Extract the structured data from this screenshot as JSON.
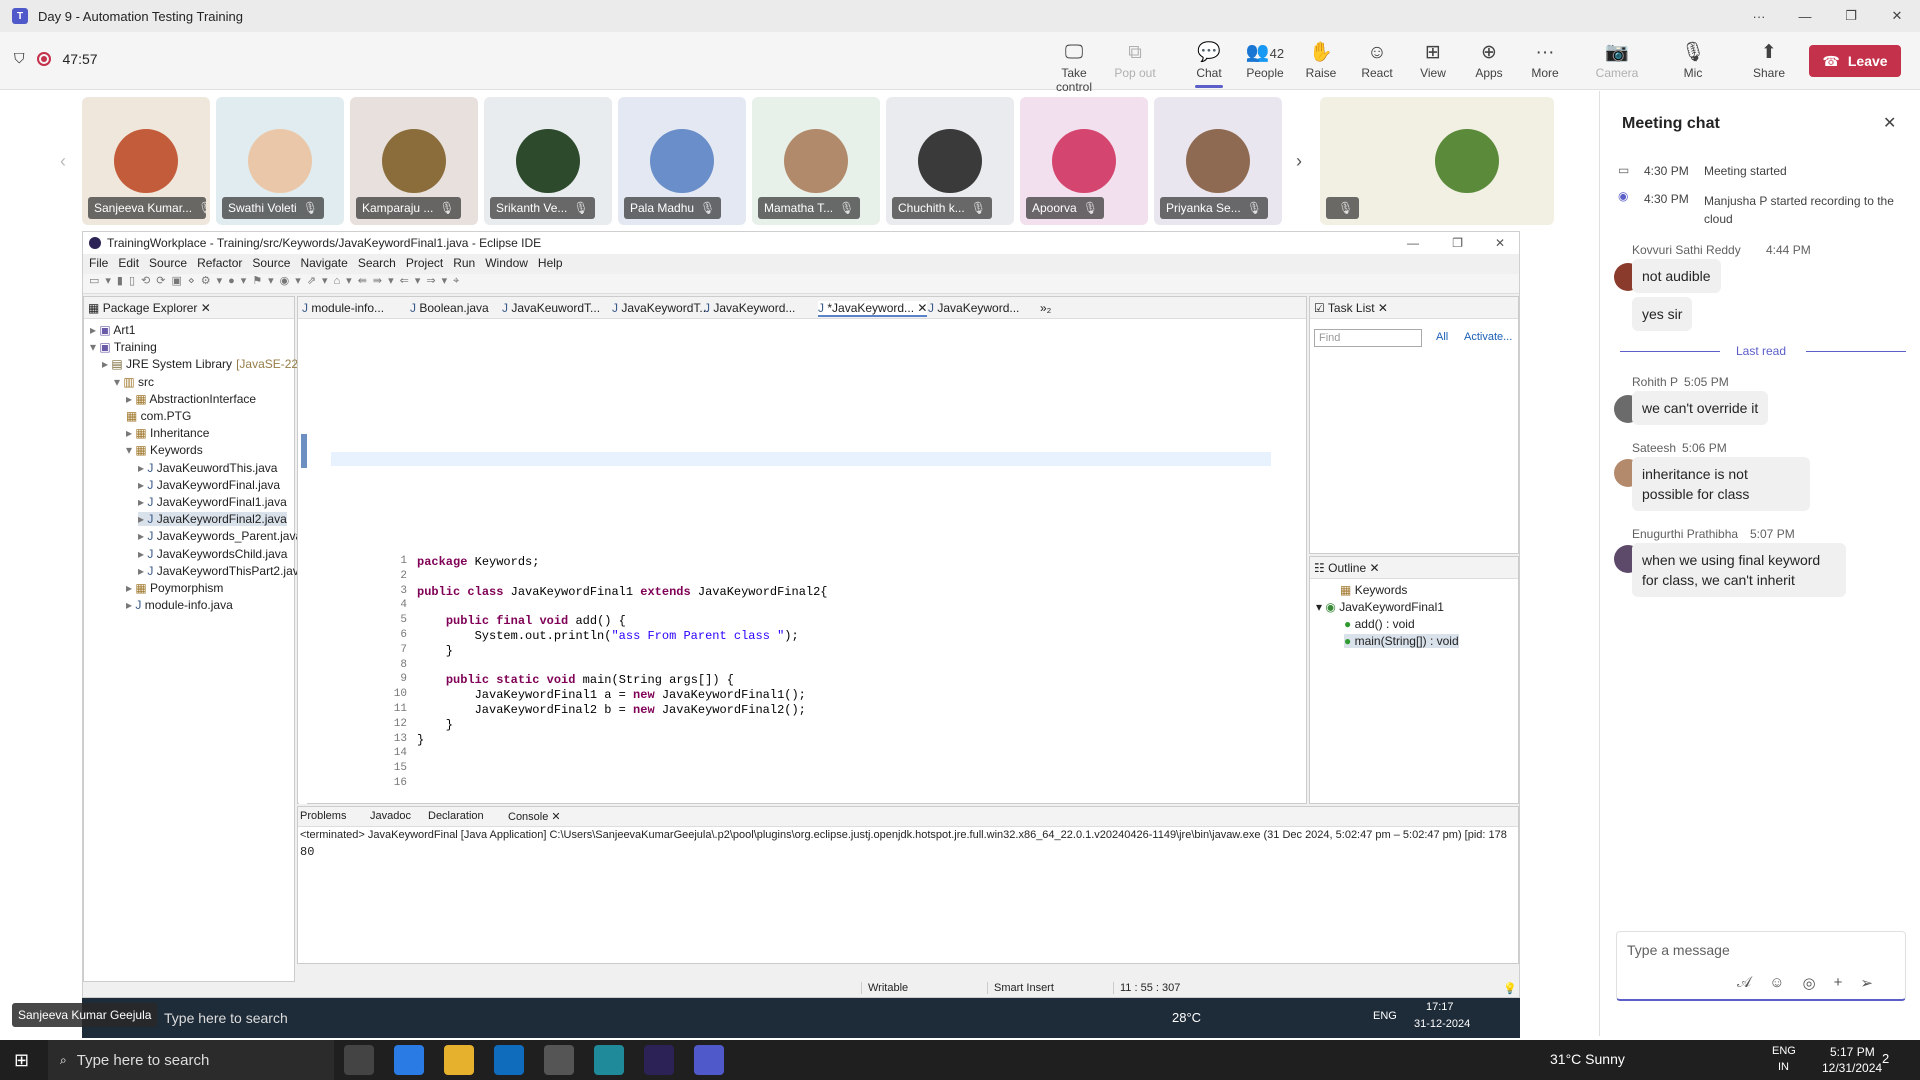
{
  "window": {
    "title": "Day 9 - Automation Testing Training"
  },
  "meeting": {
    "timer": "47:57",
    "people_count": "42"
  },
  "toolbar": {
    "take_control": "Take control",
    "pop_out": "Pop out",
    "chat": "Chat",
    "people": "People",
    "raise": "Raise",
    "react": "React",
    "view": "View",
    "apps": "Apps",
    "more": "More",
    "camera": "Camera",
    "mic": "Mic",
    "share": "Share",
    "leave": "Leave"
  },
  "participants": [
    {
      "name": "Sanjeeva Kumar..."
    },
    {
      "name": "Swathi Voleti"
    },
    {
      "name": "Kamparaju ..."
    },
    {
      "name": "Srikanth Ve..."
    },
    {
      "name": "Pala Madhu"
    },
    {
      "name": "Mamatha T..."
    },
    {
      "name": "Chuchith k..."
    },
    {
      "name": "Apoorva"
    },
    {
      "name": "Priyanka Se..."
    },
    {
      "name": ""
    }
  ],
  "chat": {
    "title": "Meeting chat",
    "events": [
      {
        "time": "4:30 PM",
        "text": "Meeting started"
      },
      {
        "time": "4:30 PM",
        "text": "Manjusha P started recording to the cloud"
      }
    ],
    "last_read": "Last read",
    "messages": [
      {
        "sender": "Kovvuri Sathi Reddy",
        "time": "4:44 PM",
        "text": "not audible"
      },
      {
        "sender": "",
        "time": "",
        "text": "yes sir"
      },
      {
        "sender": "Rohith P",
        "time": "5:05 PM",
        "text": "we can't override it"
      },
      {
        "sender": "Sateesh",
        "time": "5:06 PM",
        "text": "inheritance is not possible for class"
      },
      {
        "sender": "Enugurthi Prathibha",
        "time": "5:07 PM",
        "text": "when we using final keyword for class, we can't inherit"
      }
    ],
    "input_placeholder": "Type a message"
  },
  "eclipse": {
    "title": "TrainingWorkplace - Training/src/Keywords/JavaKeywordFinal1.java - Eclipse IDE",
    "menu": [
      "File",
      "Edit",
      "Source",
      "Refactor",
      "Source",
      "Navigate",
      "Search",
      "Project",
      "Run",
      "Window",
      "Help"
    ],
    "package_explorer": "Package Explorer",
    "tree": [
      "Art1",
      "Training",
      "JRE System Library",
      "[JavaSE-22]",
      "src",
      "AbstractionInterface",
      "com.PTG",
      "Inheritance",
      "Keywords",
      "JavaKeuwordThis.java",
      "JavaKeywordFinal.java",
      "JavaKeywordFinal1.java",
      "JavaKeywordFinal2.java",
      "JavaKeywords_Parent.java",
      "JavaKeywordsChild.java",
      "JavaKeywordThisPart2.java",
      "Poymorphism",
      "module-info.java"
    ],
    "tabs": [
      "module-info...",
      "Boolean.java",
      "JavaKeuwordT...",
      "JavaKeywordT...",
      "JavaKeyword...",
      "*JavaKeyword...",
      "JavaKeyword...",
      "»₂"
    ],
    "code_lines": [
      "package Keywords;",
      "",
      "public class JavaKeywordFinal1 extends JavaKeywordFinal2{",
      "",
      "    public final void add() {",
      "        System.out.println(\"ass From Parent class \");",
      "    }",
      "",
      "    public static void main(String args[]) {",
      "        JavaKeywordFinal1 a = new JavaKeywordFinal1();",
      "        JavaKeywordFinal2 b = new JavaKeywordFinal2();",
      "    }",
      "}",
      "",
      "",
      ""
    ],
    "task_list": "Task List",
    "find_placeholder": "Find",
    "all": "All",
    "activate": "Activate...",
    "outline": "Outline",
    "outline_items": [
      "Keywords",
      "JavaKeywordFinal1",
      "add() : void",
      "main(String[]) : void"
    ],
    "bottom_tabs": [
      "Problems",
      "Javadoc",
      "Declaration",
      "Console"
    ],
    "console_header": "<terminated> JavaKeywordFinal [Java Application] C:\\Users\\SanjeevaKumarGeejula\\.p2\\pool\\plugins\\org.eclipse.justj.openjdk.hotspot.jre.full.win32.x86_64_22.0.1.v20240426-1149\\jre\\bin\\javaw.exe  (31 Dec 2024, 5:02:47 pm – 5:02:47 pm) [pid: 178",
    "console_output": "80",
    "status": {
      "writable": "Writable",
      "insert": "Smart Insert",
      "position": "11 : 55 : 307"
    }
  },
  "inner_taskbar": {
    "search": "Type here to search",
    "temp": "28°C",
    "lang": "ENG",
    "time": "17:17",
    "date": "31-12-2024",
    "presenter": "Sanjeeva Kumar Geejula"
  },
  "taskbar": {
    "search": "Type here to search",
    "weather": "31°C  Sunny",
    "lang": "ENG",
    "region": "IN",
    "time": "5:17 PM",
    "date": "12/31/2024",
    "notif": "2"
  }
}
